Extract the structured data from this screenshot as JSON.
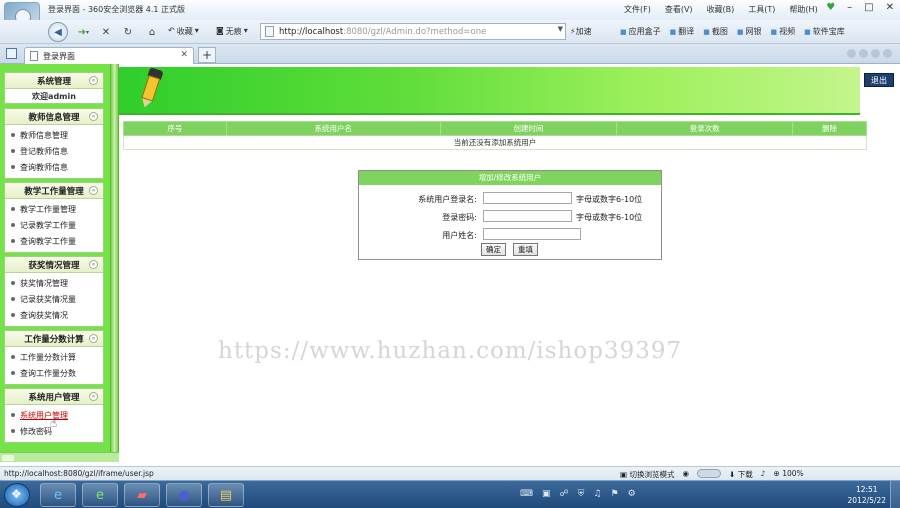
{
  "browser": {
    "window_title": "登录界面 - 360安全浏览器 4.1 正式版",
    "menu": [
      "文件(F)",
      "查看(V)",
      "收藏(B)",
      "工具(T)",
      "帮助(H)"
    ],
    "nav": {
      "back_label": "收藏",
      "view_label": "无痕"
    },
    "url_host": "http://localhost",
    "url_path": ":8080/gzl/Admin.do?method=one",
    "accelerate_label": "加速",
    "toolbar_right": [
      "应用盒子",
      "翻译",
      "截图",
      "网银",
      "视频",
      "软件宝库"
    ],
    "tab_title": "登录界面",
    "status_url": "http://localhost:8080/gzl/iframe/user.jsp",
    "status_mode": "切换浏览模式",
    "status_download": "下载",
    "status_zoom": "100%"
  },
  "sidebar": {
    "groups": [
      {
        "title": "系统管理",
        "welcome": "欢迎admin",
        "items": []
      },
      {
        "title": "教师信息管理",
        "items": [
          "教师信息管理",
          "登记教师信息",
          "查询教师信息"
        ]
      },
      {
        "title": "教学工作量管理",
        "items": [
          "教学工作量管理",
          "记录教学工作量",
          "查询教学工作量"
        ]
      },
      {
        "title": "获奖情况管理",
        "items": [
          "获奖情况管理",
          "记录获奖情况量",
          "查询获奖情况"
        ]
      },
      {
        "title": "工作量分数计算",
        "items": [
          "工作量分数计算",
          "查询工作量分数"
        ]
      },
      {
        "title": "系统用户管理",
        "items": [
          "系统用户管理",
          "修改密码"
        ]
      }
    ],
    "active_item": "系统用户管理"
  },
  "header": {
    "logout_label": "退出"
  },
  "users_table": {
    "columns": [
      "序号",
      "系统用户名",
      "创建时间",
      "登录次数",
      "删除"
    ],
    "empty_message": "当前还没有添加系统用户"
  },
  "user_form": {
    "title": "增加/修改系统用户",
    "fields": [
      {
        "label": "系统用户登录名:",
        "hint": "字母或数字6-10位",
        "value": ""
      },
      {
        "label": "登录密码:",
        "hint": "字母或数字6-10位",
        "value": ""
      },
      {
        "label": "用户姓名:",
        "hint": "",
        "value": ""
      }
    ],
    "confirm_label": "确定",
    "reset_label": "重填"
  },
  "watermark_text": "https://www.huzhan.com/ishop39397",
  "taskbar": {
    "time": "12:51",
    "date": "2012/5/22"
  },
  "colors": {
    "sidebar_green": "#76e24a",
    "table_header_green": "#7fd260",
    "logout_navy": "#1d3f6b",
    "active_link_red": "#cc0000"
  }
}
